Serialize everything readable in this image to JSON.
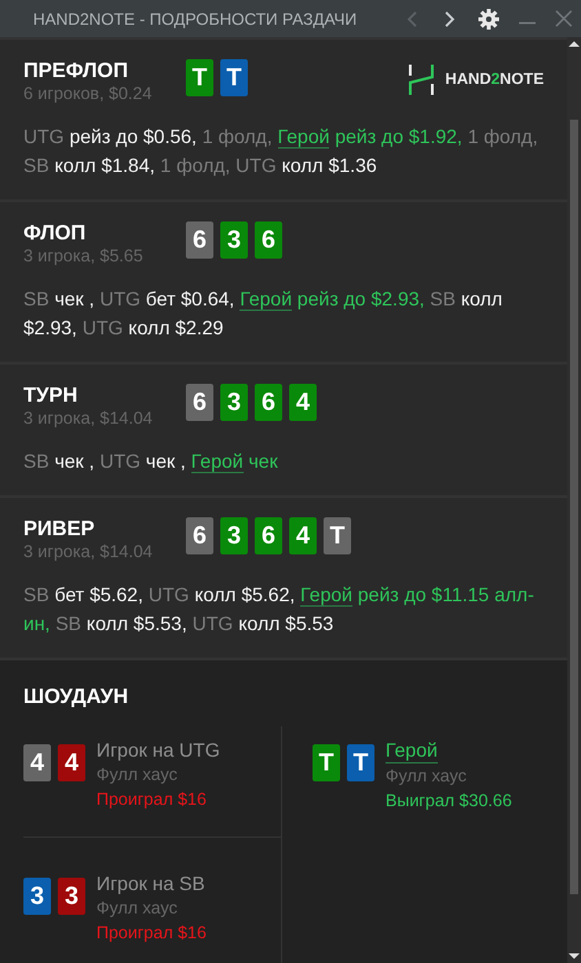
{
  "window": {
    "title": "HAND2NOTE - ПОДРОБНОСТИ РАЗДАЧИ",
    "nav": [
      {
        "kind": "prev",
        "disabled": true
      },
      {
        "kind": "next",
        "disabled": false
      }
    ]
  },
  "logo": {
    "parts": [
      "HAND",
      "2",
      "NOTE"
    ]
  },
  "streets": [
    {
      "name": "ПРЕФЛОП",
      "info": "6 игроков, $0.24",
      "cards": [
        {
          "rank": "T",
          "color": "#0a8a0a"
        },
        {
          "rank": "T",
          "color": "#0b5fae"
        }
      ],
      "actions": [
        {
          "kind": "pos",
          "text": "UTG "
        },
        {
          "kind": "act",
          "text": "рейз до $0.56, "
        },
        {
          "kind": "pos",
          "text": "1 фолд, "
        },
        {
          "kind": "hero",
          "text": "Герой"
        },
        {
          "kind": "herotext",
          "text": " рейз до $1.92, "
        },
        {
          "kind": "pos",
          "text": "1 фолд, SB "
        },
        {
          "kind": "act",
          "text": "колл $1.84, "
        },
        {
          "kind": "pos",
          "text": "1 фолд, UTG "
        },
        {
          "kind": "act",
          "text": "колл $1.36"
        }
      ]
    },
    {
      "name": "ФЛОП",
      "info": "3 игрока, $5.65",
      "cards": [
        {
          "rank": "6",
          "color": "#666666"
        },
        {
          "rank": "3",
          "color": "#0a8a0a"
        },
        {
          "rank": "6",
          "color": "#0a8a0a"
        }
      ],
      "actions": [
        {
          "kind": "pos",
          "text": "SB "
        },
        {
          "kind": "act",
          "text": "чек , "
        },
        {
          "kind": "pos",
          "text": "UTG "
        },
        {
          "kind": "act",
          "text": "бет $0.64, "
        },
        {
          "kind": "hero",
          "text": "Герой"
        },
        {
          "kind": "herotext",
          "text": " рейз до $2.93, "
        },
        {
          "kind": "pos",
          "text": "SB "
        },
        {
          "kind": "act",
          "text": "колл $2.93, "
        },
        {
          "kind": "pos",
          "text": "UTG "
        },
        {
          "kind": "act",
          "text": "колл $2.29"
        }
      ]
    },
    {
      "name": "ТУРН",
      "info": "3 игрока, $14.04",
      "cards": [
        {
          "rank": "6",
          "color": "#666666"
        },
        {
          "rank": "3",
          "color": "#0a8a0a"
        },
        {
          "rank": "6",
          "color": "#0a8a0a"
        },
        {
          "rank": "4",
          "color": "#0a8a0a"
        }
      ],
      "actions": [
        {
          "kind": "pos",
          "text": "SB "
        },
        {
          "kind": "act",
          "text": "чек , "
        },
        {
          "kind": "pos",
          "text": "UTG "
        },
        {
          "kind": "act",
          "text": "чек , "
        },
        {
          "kind": "hero",
          "text": "Герой"
        },
        {
          "kind": "herotext",
          "text": " чек"
        }
      ]
    },
    {
      "name": "РИВЕР",
      "info": "3 игрока, $14.04",
      "cards": [
        {
          "rank": "6",
          "color": "#666666"
        },
        {
          "rank": "3",
          "color": "#0a8a0a"
        },
        {
          "rank": "6",
          "color": "#0a8a0a"
        },
        {
          "rank": "4",
          "color": "#0a8a0a"
        },
        {
          "rank": "T",
          "color": "#666666"
        }
      ],
      "actions": [
        {
          "kind": "pos",
          "text": "SB "
        },
        {
          "kind": "act",
          "text": "бет $5.62, "
        },
        {
          "kind": "pos",
          "text": "UTG "
        },
        {
          "kind": "act",
          "text": "колл $5.62, "
        },
        {
          "kind": "hero",
          "text": "Герой"
        },
        {
          "kind": "herotext",
          "text": " рейз до $11.15 алл-ин, "
        },
        {
          "kind": "pos",
          "text": "SB "
        },
        {
          "kind": "act",
          "text": "колл $5.53, "
        },
        {
          "kind": "pos",
          "text": "UTG "
        },
        {
          "kind": "act",
          "text": "колл $5.53"
        }
      ]
    }
  ],
  "showdown": {
    "title": "ШОУДАУН",
    "players": [
      {
        "cards": [
          {
            "rank": "4",
            "color": "#666666"
          },
          {
            "rank": "4",
            "color": "#a00a0a"
          }
        ],
        "name": "Игрок на UTG",
        "hero": false,
        "hand": "Фулл хаус",
        "result": "Проиграл $16",
        "won": false
      },
      {
        "cards": [
          {
            "rank": "T",
            "color": "#0a8a0a"
          },
          {
            "rank": "T",
            "color": "#0b5fae"
          }
        ],
        "name": "Герой",
        "hero": true,
        "hand": "Фулл хаус",
        "result": "Выиграл $30.66",
        "won": true
      },
      {
        "cards": [
          {
            "rank": "3",
            "color": "#0b5fae"
          },
          {
            "rank": "3",
            "color": "#a00a0a"
          }
        ],
        "name": "Игрок на SB",
        "hero": false,
        "hand": "Фулл хаус",
        "result": "Проиграл $16",
        "won": false
      }
    ]
  }
}
